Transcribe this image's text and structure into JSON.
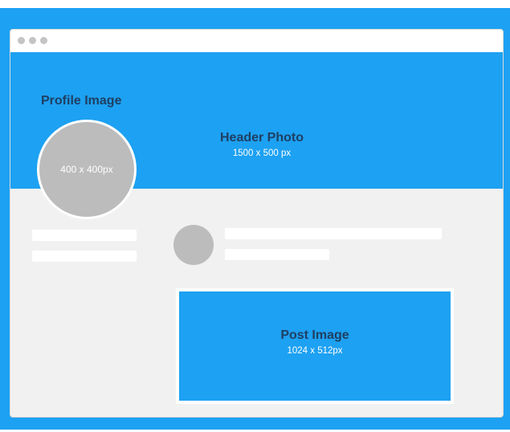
{
  "colors": {
    "brand_blue": "#1da1f2",
    "placeholder_gray": "#bcbcbc",
    "background": "#f1f1f1",
    "label_navy": "#1f3f63"
  },
  "window": {
    "controls": [
      "dot",
      "dot",
      "dot"
    ]
  },
  "header": {
    "title": "Header Photo",
    "size": "1500 x 500 px"
  },
  "profile": {
    "label": "Profile Image",
    "size": "400 x 400px"
  },
  "post": {
    "title": "Post Image",
    "size": "1024 x 512px"
  }
}
